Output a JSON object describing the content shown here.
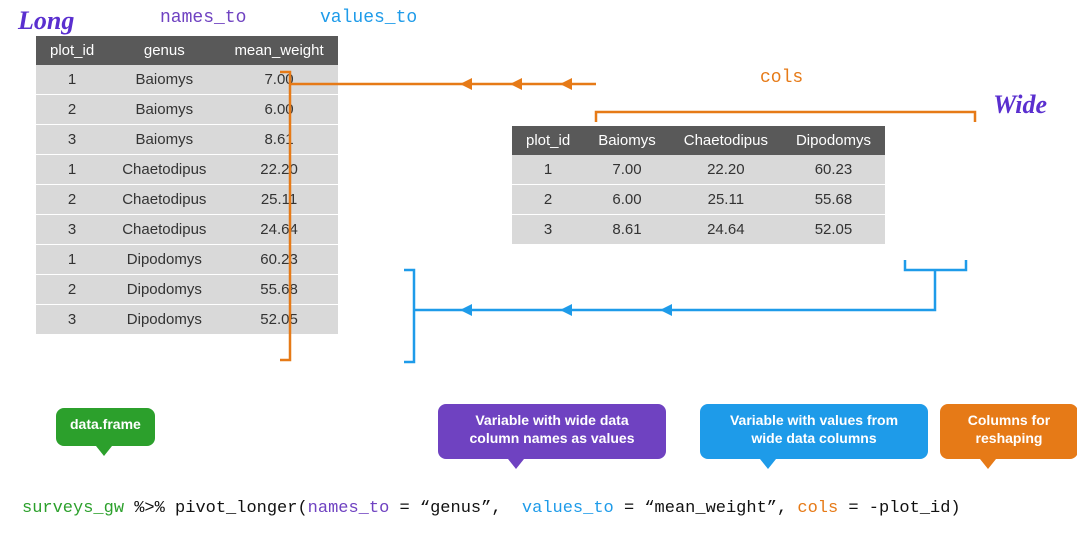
{
  "labels": {
    "long": "Long",
    "wide": "Wide",
    "names_to": "names_to",
    "values_to": "values_to",
    "cols": "cols"
  },
  "long_table": {
    "headers": [
      "plot_id",
      "genus",
      "mean_weight"
    ],
    "rows": [
      [
        "1",
        "Baiomys",
        "7.00"
      ],
      [
        "2",
        "Baiomys",
        "6.00"
      ],
      [
        "3",
        "Baiomys",
        "8.61"
      ],
      [
        "1",
        "Chaetodipus",
        "22.20"
      ],
      [
        "2",
        "Chaetodipus",
        "25.11"
      ],
      [
        "3",
        "Chaetodipus",
        "24.64"
      ],
      [
        "1",
        "Dipodomys",
        "60.23"
      ],
      [
        "2",
        "Dipodomys",
        "55.68"
      ],
      [
        "3",
        "Dipodomys",
        "52.05"
      ]
    ]
  },
  "wide_table": {
    "headers": [
      "plot_id",
      "Baiomys",
      "Chaetodipus",
      "Dipodomys"
    ],
    "rows": [
      [
        "1",
        "7.00",
        "22.20",
        "60.23"
      ],
      [
        "2",
        "6.00",
        "25.11",
        "55.68"
      ],
      [
        "3",
        "8.61",
        "24.64",
        "52.05"
      ]
    ]
  },
  "bubbles": {
    "green": "data.frame",
    "purple": "Variable with wide data column names as values",
    "blue": "Variable with values from wide data columns",
    "orange": "Columns for reshaping"
  },
  "code": {
    "df": "surveys_gw",
    "pipe_fn": " %>% pivot_longer(",
    "names_kw": "names_to",
    "eq1": " = “genus”,  ",
    "values_kw": "values_to",
    "eq2": " = “mean_weight”, ",
    "cols_kw": "cols",
    "eq3": " = -plot_id)"
  },
  "chart_data": {
    "type": "table",
    "description": "Wide-to-long reshape with pivot_longer",
    "wide": {
      "plot_id": [
        1,
        2,
        3
      ],
      "Baiomys": [
        7.0,
        6.0,
        8.61
      ],
      "Chaetodipus": [
        22.2,
        25.11,
        24.64
      ],
      "Dipodomys": [
        60.23,
        55.68,
        52.05
      ]
    },
    "long": [
      {
        "plot_id": 1,
        "genus": "Baiomys",
        "mean_weight": 7.0
      },
      {
        "plot_id": 2,
        "genus": "Baiomys",
        "mean_weight": 6.0
      },
      {
        "plot_id": 3,
        "genus": "Baiomys",
        "mean_weight": 8.61
      },
      {
        "plot_id": 1,
        "genus": "Chaetodipus",
        "mean_weight": 22.2
      },
      {
        "plot_id": 2,
        "genus": "Chaetodipus",
        "mean_weight": 25.11
      },
      {
        "plot_id": 3,
        "genus": "Chaetodipus",
        "mean_weight": 24.64
      },
      {
        "plot_id": 1,
        "genus": "Dipodomys",
        "mean_weight": 60.23
      },
      {
        "plot_id": 2,
        "genus": "Dipodomys",
        "mean_weight": 55.68
      },
      {
        "plot_id": 3,
        "genus": "Dipodomys",
        "mean_weight": 52.05
      }
    ],
    "pivot_longer_args": {
      "names_to": "genus",
      "values_to": "mean_weight",
      "cols": "-plot_id"
    }
  }
}
